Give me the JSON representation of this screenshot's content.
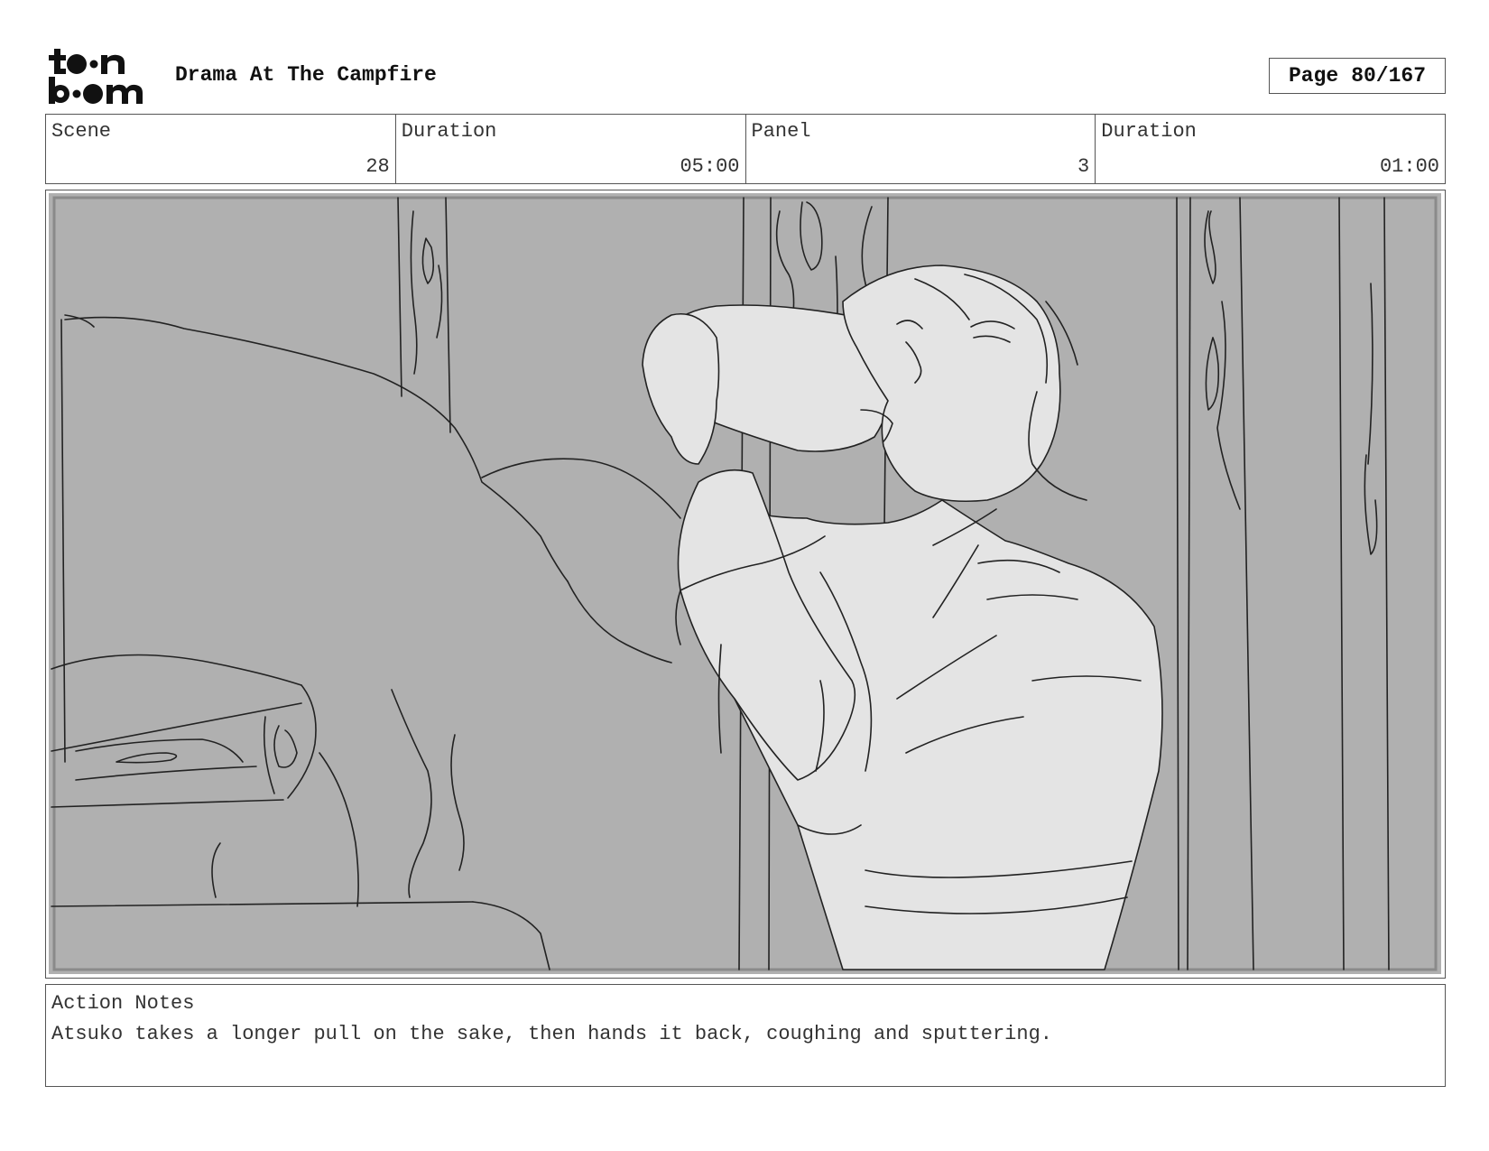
{
  "header": {
    "logo_text": "toon boom",
    "title": "Drama At The Campfire",
    "page_label": "Page",
    "page_value": "80/167"
  },
  "info": {
    "scene_label": "Scene",
    "scene_value": "28",
    "scene_duration_label": "Duration",
    "scene_duration_value": "05:00",
    "panel_label": "Panel",
    "panel_value": "3",
    "panel_duration_label": "Duration",
    "panel_duration_value": "01:00"
  },
  "panel_image": {
    "subject": "storyboard sketch"
  },
  "notes": {
    "label": "Action Notes",
    "text": "Atsuko takes a longer pull on the sake, then hands it back, coughing and sputtering."
  }
}
